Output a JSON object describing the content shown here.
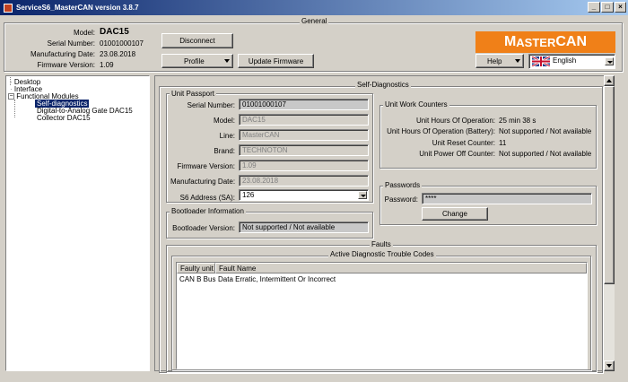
{
  "window": {
    "title": "ServiceS6_MasterCAN version 3.8.7"
  },
  "general": {
    "legend": "General",
    "model_label": "Model:",
    "model_value": "DAC15",
    "serial_label": "Serial Number:",
    "serial_value": "01001000107",
    "mfg_label": "Manufacturing Date:",
    "mfg_value": "23.08.2018",
    "fw_label": "Firmware Version:",
    "fw_value": "1.09",
    "disconnect": "Disconnect",
    "profile": "Profile",
    "update_fw": "Update Firmware",
    "help": "Help",
    "language": "English",
    "logo_big": "M",
    "logo_text": "ASTER",
    "logo_big2": "CAN"
  },
  "tree": {
    "items": [
      "Desktop",
      "Interface",
      "Functional Modules",
      "Self-diagnostics",
      "Digital-to-Analog Gate DAC15",
      "Collector DAC15"
    ]
  },
  "selfdiag": {
    "legend": "Self-Diagnostics",
    "passport": {
      "legend": "Unit Passport",
      "serial_label": "Serial Number:",
      "serial_value": "01001000107",
      "model_label": "Model:",
      "model_value": "DAC15",
      "line_label": "Line:",
      "line_value": "MasterCAN",
      "brand_label": "Brand:",
      "brand_value": "TECHNOTON",
      "fw_label": "Firmware Version:",
      "fw_value": "1.09",
      "mfg_label": "Manufacturing Date:",
      "mfg_value": "23.08.2018",
      "sa_label": "S6 Address (SA):",
      "sa_value": "126"
    },
    "boot": {
      "legend": "Bootloader Information",
      "version_label": "Bootloader Version:",
      "version_value": "Not supported / Not available"
    },
    "counters": {
      "legend": "Unit Work Counters",
      "rows": [
        {
          "label": "Unit Hours Of Operation:",
          "value": "25 min 38 s"
        },
        {
          "label": "Unit Hours Of Operation (Battery):",
          "value": "Not supported / Not available"
        },
        {
          "label": "Unit Reset Counter:",
          "value": "11"
        },
        {
          "label": "Unit Power Off Counter:",
          "value": "Not supported / Not available"
        }
      ]
    },
    "passwords": {
      "legend": "Passwords",
      "password_label": "Password:",
      "password_value": "****",
      "change": "Change"
    },
    "faults": {
      "legend": "Faults",
      "dtc_legend": "Active Diagnostic Trouble Codes",
      "columns": [
        "Faulty unit",
        "Fault Name"
      ],
      "rows": [
        [
          "CAN B Bus",
          "Data Erratic, Intermittent Or Incorrect"
        ]
      ]
    }
  },
  "colors": {
    "titlebar": "#0a246a",
    "accent": "#f08018",
    "selection": "#0a246a"
  }
}
